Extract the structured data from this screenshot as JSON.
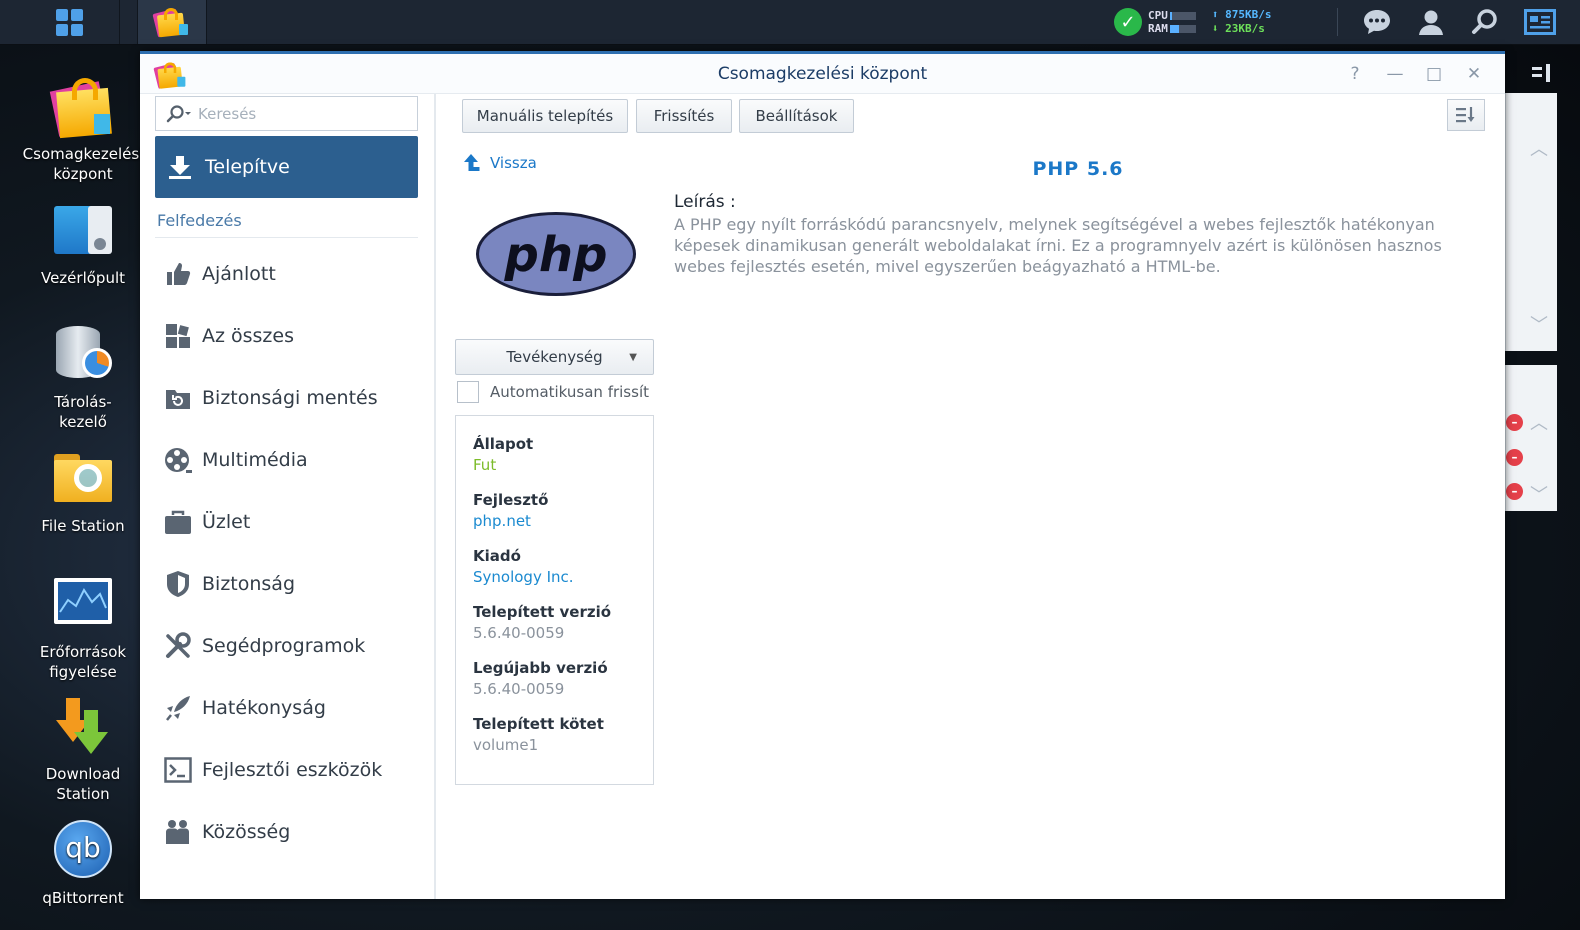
{
  "taskbar": {
    "cpu_label": "CPU",
    "ram_label": "RAM",
    "cpu_usage": 0.1,
    "ram_usage": 0.35,
    "upload": "875KB/s",
    "download": "23KB/s"
  },
  "desktop": {
    "icons": [
      {
        "label1": "Csomagkezelési",
        "label2": "központ"
      },
      {
        "label1": "Vezérlőpult",
        "label2": ""
      },
      {
        "label1": "Tárolás-",
        "label2": "kezelő"
      },
      {
        "label1": "File Station",
        "label2": ""
      },
      {
        "label1": "Erőforrások",
        "label2": "figyelése"
      },
      {
        "label1": "Download Station",
        "label2": ""
      },
      {
        "label1": "qBittorrent",
        "label2": ""
      }
    ]
  },
  "window": {
    "title": "Csomagkezelési központ",
    "controls": {
      "help": "?",
      "minimize": "—",
      "maximize": "□",
      "close": "✕"
    }
  },
  "sidebar": {
    "search_placeholder": "Keresés",
    "installed": "Telepítve",
    "discover_heading": "Felfedezés",
    "items": [
      {
        "label": "Ajánlott",
        "icon": "thumbs-up-icon"
      },
      {
        "label": "Az összes",
        "icon": "grid-icon"
      },
      {
        "label": "Biztonsági mentés",
        "icon": "backup-icon"
      },
      {
        "label": "Multimédia",
        "icon": "film-reel-icon"
      },
      {
        "label": "Üzlet",
        "icon": "briefcase-icon"
      },
      {
        "label": "Biztonság",
        "icon": "shield-icon"
      },
      {
        "label": "Segédprogramok",
        "icon": "tools-icon"
      },
      {
        "label": "Hatékonyság",
        "icon": "rocket-icon"
      },
      {
        "label": "Fejlesztői eszközök",
        "icon": "terminal-icon"
      },
      {
        "label": "Közösség",
        "icon": "people-icon"
      }
    ]
  },
  "toolbar": {
    "manual_install": "Manuális telepítés",
    "refresh": "Frissítés",
    "settings": "Beállítások"
  },
  "package": {
    "back": "Vissza",
    "title": "PHP 5.6",
    "logo_text": "php",
    "description_label": "Leírás :",
    "description": "A PHP egy nyílt forráskódú parancsnyelv, melynek segítségével a webes fejlesztők hatékonyan képesek dinamikusan generált weboldalakat írni. Ez a programnyelv azért is különösen hasznos webes fejlesztés esetén, mivel egyszerűen beágyazható a HTML-be.",
    "action_button": "Tevékenység",
    "auto_update": "Automatikusan frissít",
    "info": {
      "status_label": "Állapot",
      "status": "Fut",
      "developer_label": "Fejlesztő",
      "developer": "php.net",
      "publisher_label": "Kiadó",
      "publisher": "Synology Inc.",
      "installed_version_label": "Telepített verzió",
      "installed_version": "5.6.40-0059",
      "latest_version_label": "Legújabb verzió",
      "latest_version": "5.6.40-0059",
      "volume_label": "Telepített kötet",
      "volume": "volume1"
    }
  }
}
